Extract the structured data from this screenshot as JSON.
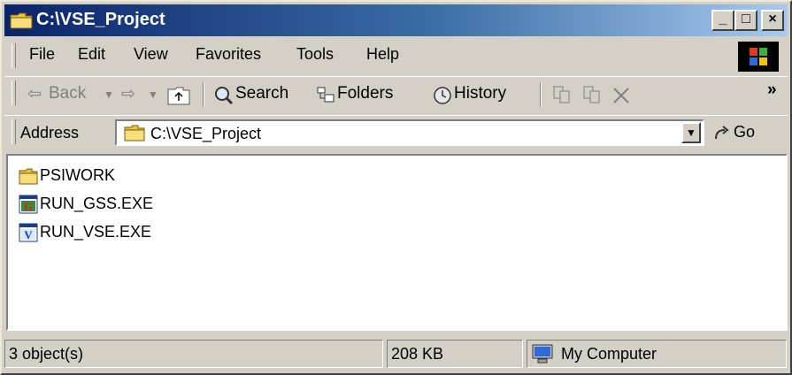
{
  "window": {
    "title": "C:\\VSE_Project"
  },
  "caption_buttons": {
    "minimize": "_",
    "maximize": "□",
    "close": "×"
  },
  "menu": [
    "File",
    "Edit",
    "View",
    "Favorites",
    "Tools",
    "Help"
  ],
  "toolbar": {
    "back": "Back",
    "search": "Search",
    "folders": "Folders",
    "history": "History",
    "overflow": "»"
  },
  "address": {
    "label": "Address",
    "value": "C:\\VSE_Project",
    "go": "Go"
  },
  "files": [
    {
      "name": "PSIWORK",
      "icon": "folder-icon"
    },
    {
      "name": "RUN_GSS.EXE",
      "icon": "gss-exe-icon"
    },
    {
      "name": "RUN_VSE.EXE",
      "icon": "vse-exe-icon"
    }
  ],
  "status": {
    "objects": "3 object(s)",
    "size": "208 KB",
    "zone": "My Computer"
  },
  "colors": {
    "titlebar_start": "#0a246a",
    "titlebar_end": "#a6caf0",
    "face": "#d4d0c8"
  }
}
